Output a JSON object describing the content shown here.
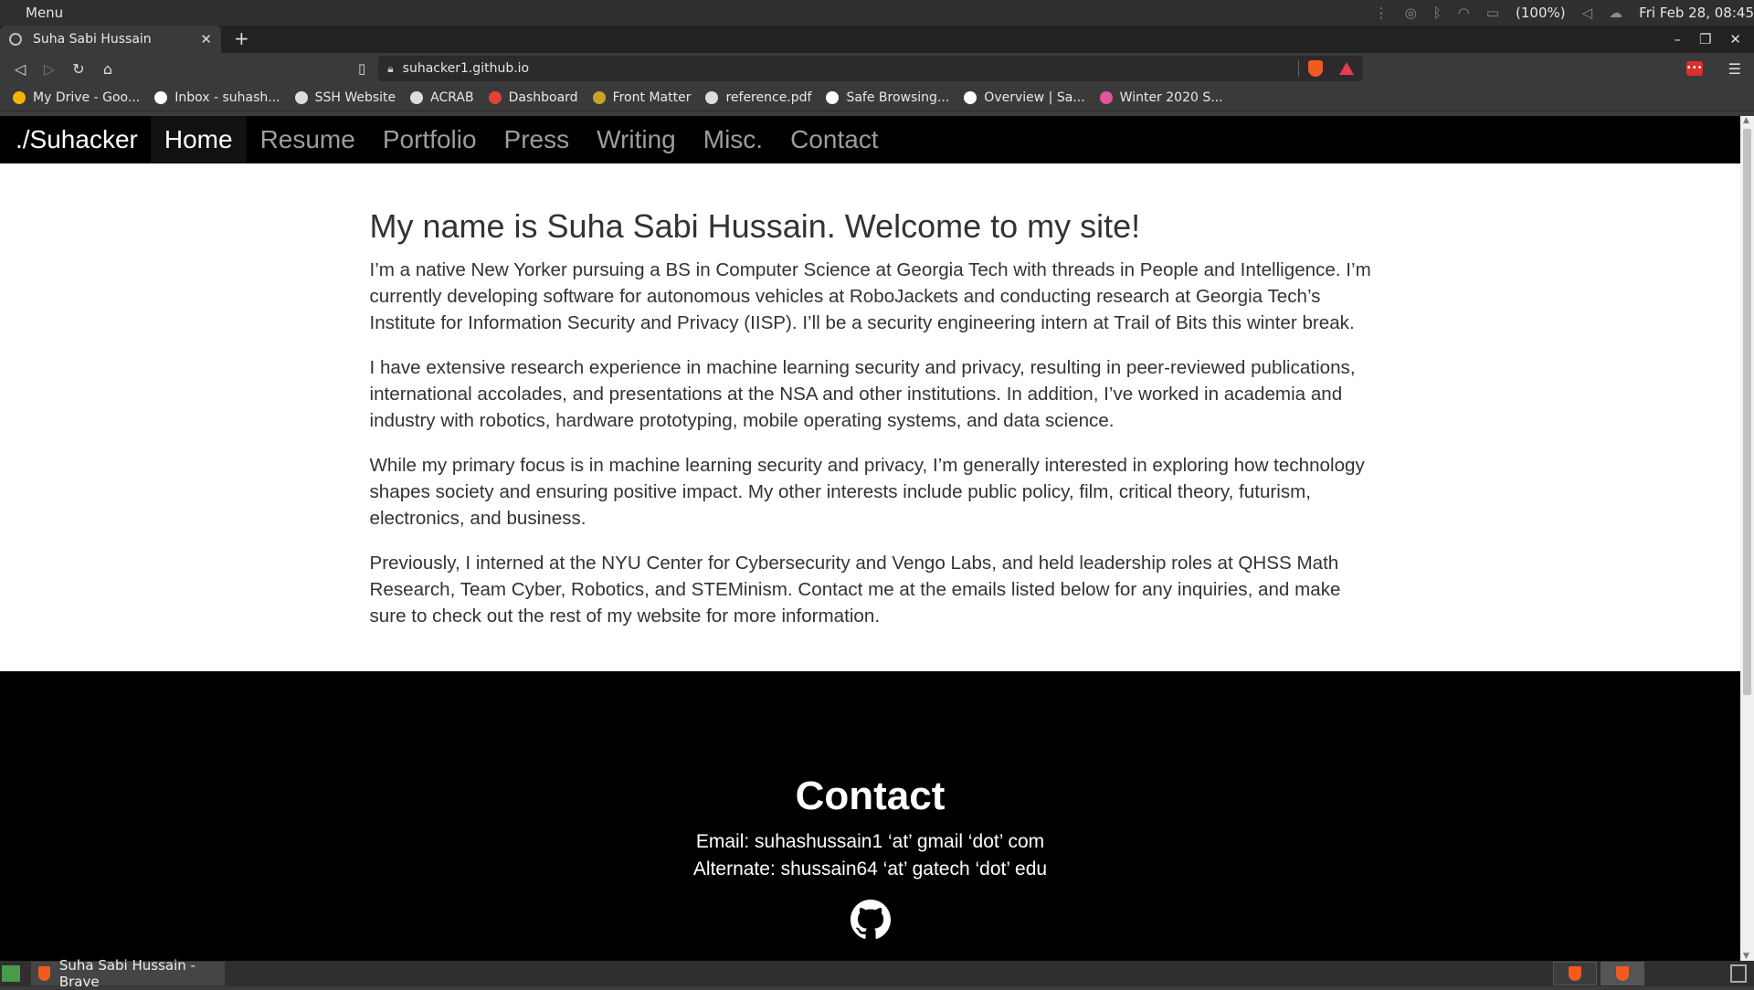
{
  "os": {
    "menu_label": "Menu",
    "battery": "(100%)",
    "clock": "Fri Feb 28, 08:45"
  },
  "browser": {
    "tab_title": "Suha Sabi Hussain",
    "url": "suhacker1.github.io",
    "bookmarks": [
      {
        "label": "My Drive - Goo...",
        "color": "#f4b400"
      },
      {
        "label": "Inbox - suhash...",
        "color": "#ffffff"
      },
      {
        "label": "SSH Website",
        "color": "#dddddd"
      },
      {
        "label": "ACRAB",
        "color": "#dddddd"
      },
      {
        "label": "Dashboard",
        "color": "#e34234"
      },
      {
        "label": "Front Matter",
        "color": "#c9a227"
      },
      {
        "label": "reference.pdf",
        "color": "#dddddd"
      },
      {
        "label": "Safe Browsing...",
        "color": "#ffffff"
      },
      {
        "label": "Overview | Sa...",
        "color": "#ffffff"
      },
      {
        "label": "Winter 2020 S...",
        "color": "#e0559b"
      }
    ]
  },
  "site": {
    "brand": "./Suhacker",
    "nav": [
      "Home",
      "Resume",
      "Portfolio",
      "Press",
      "Writing",
      "Misc.",
      "Contact"
    ],
    "active_nav": "Home",
    "heading": "My name is Suha Sabi Hussain. Welcome to my site!",
    "paragraphs": [
      "I’m a native New Yorker pursuing a BS in Computer Science at Georgia Tech with threads in People and Intelligence. I’m currently developing software for autonomous vehicles at RoboJackets and conducting research at Georgia Tech’s Institute for Information Security and Privacy (IISP). I’ll be a security engineering intern at Trail of Bits this winter break.",
      "I have extensive research experience in machine learning security and privacy, resulting in peer-reviewed publications, international accolades, and presentations at the NSA and other institutions. In addition, I’ve worked in academia and industry with robotics, hardware prototyping, mobile operating systems, and data science.",
      "While my primary focus is in machine learning security and privacy, I’m generally interested in exploring how technology shapes society and ensuring positive impact. My other interests include public policy, film, critical theory, futurism, electronics, and business.",
      "Previously, I interned at the NYU Center for Cybersecurity and Vengo Labs, and held leadership roles at QHSS Math Research, Team Cyber, Robotics, and STEMinism. Contact me at the emails listed below for any inquiries, and make sure to check out the rest of my website for more information."
    ],
    "footer": {
      "heading": "Contact",
      "email": "Email: suhashussain1 ‘at’ gmail ‘dot’ com",
      "alternate": "Alternate: shussain64 ‘at’ gatech ‘dot’ edu",
      "icon": "github-icon"
    }
  },
  "taskbar": {
    "window_label": "Suha Sabi Hussain - Brave"
  }
}
